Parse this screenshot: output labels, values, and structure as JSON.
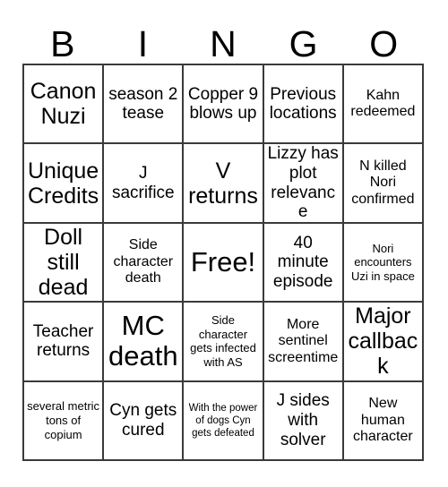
{
  "card": {
    "header_letters": [
      "B",
      "I",
      "N",
      "G",
      "O"
    ],
    "grid": {
      "rows": 5,
      "columns": 5,
      "border_color": "#3a3a3a",
      "background_color": "#ffffff",
      "text_color": "#000000",
      "free_space_index": 12
    },
    "cells": [
      {
        "text": "Canon Nuzi",
        "size": "lg"
      },
      {
        "text": "season 2 tease",
        "size": "md"
      },
      {
        "text": "Copper 9 blows up",
        "size": "md"
      },
      {
        "text": "Previous locations",
        "size": "md"
      },
      {
        "text": "Kahn redeemed",
        "size": "sm"
      },
      {
        "text": "Unique Credits",
        "size": "lg"
      },
      {
        "text": "J sacrifice",
        "size": "md"
      },
      {
        "text": "V returns",
        "size": "lg"
      },
      {
        "text": "Lizzy has plot relevance",
        "size": "md"
      },
      {
        "text": "N killed Nori confirmed",
        "size": "sm"
      },
      {
        "text": "Doll still dead",
        "size": "lg"
      },
      {
        "text": "Side character death",
        "size": "sm"
      },
      {
        "text": "Free!",
        "size": "xl"
      },
      {
        "text": "40 minute episode",
        "size": "md"
      },
      {
        "text": "Nori encounters Uzi in space",
        "size": "xs"
      },
      {
        "text": "Teacher returns",
        "size": "md"
      },
      {
        "text": "MC death",
        "size": "xl"
      },
      {
        "text": "Side character gets infected with AS",
        "size": "xs"
      },
      {
        "text": "More sentinel screentime",
        "size": "sm"
      },
      {
        "text": "Major callback",
        "size": "lg"
      },
      {
        "text": "several metric tons of copium",
        "size": "xs"
      },
      {
        "text": "Cyn gets cured",
        "size": "md"
      },
      {
        "text": "With the power of dogs Cyn gets defeated",
        "size": "xxs"
      },
      {
        "text": "J sides with solver",
        "size": "md"
      },
      {
        "text": "New human character",
        "size": "sm"
      }
    ]
  }
}
